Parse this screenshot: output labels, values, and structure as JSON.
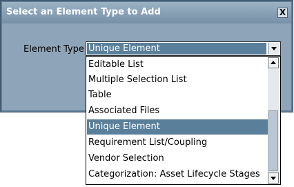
{
  "dialog": {
    "title": "Select an Element Type to Add",
    "close_glyph": "X"
  },
  "form": {
    "label": "Element Type",
    "selected_value": "Unique Element"
  },
  "dropdown": {
    "options": [
      "Editable List",
      "Multiple Selection List",
      "Table",
      "Associated Files",
      "Unique Element",
      "Requirement List/Coupling",
      "Vendor Selection",
      "Categorization: Asset Lifecycle Stages"
    ],
    "selected_index": 4
  },
  "icons": {
    "close": "close-icon",
    "dropdown_arrow": "chevron-down-icon",
    "scroll_up": "scroll-up-arrow-icon",
    "scroll_down": "scroll-down-arrow-icon"
  },
  "colors": {
    "dialog_bg": "#8ea5b9",
    "title_bg": "#879fb4",
    "selection": "#5a7f9a"
  }
}
